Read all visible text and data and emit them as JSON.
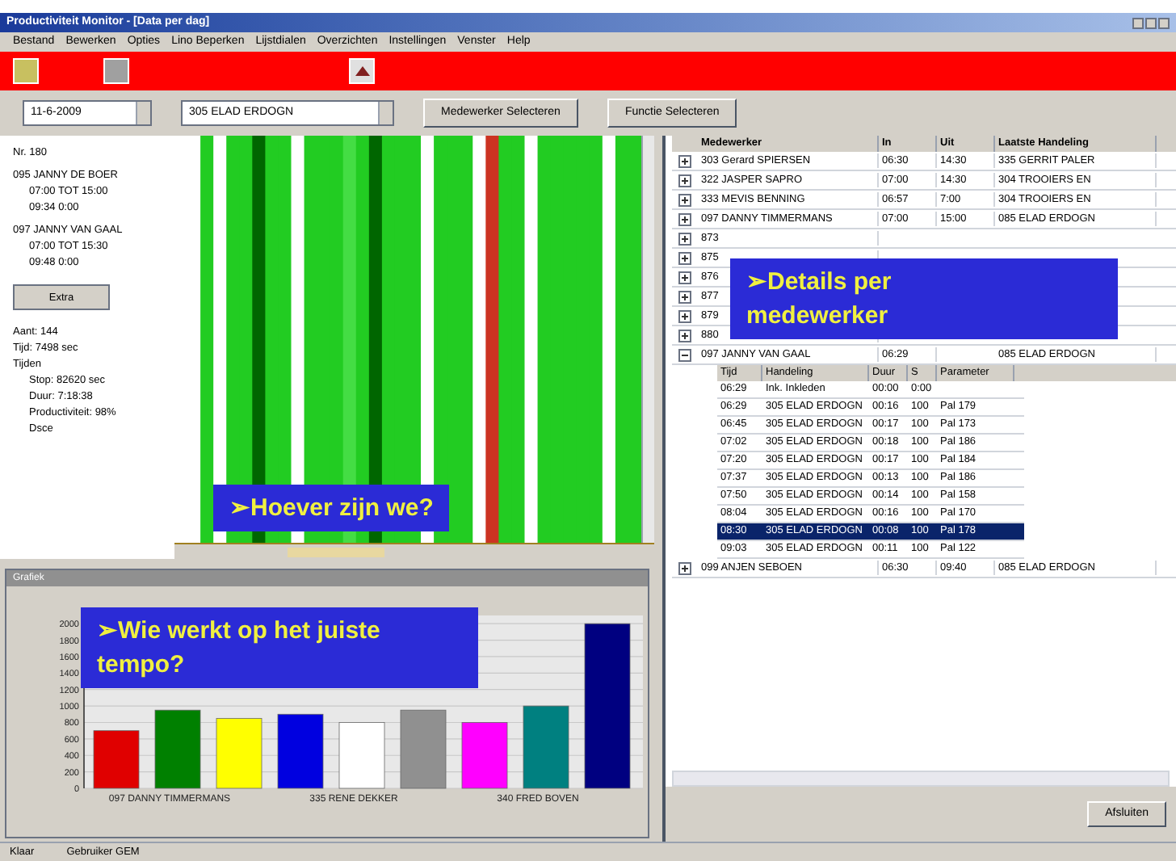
{
  "window": {
    "title": "Productiviteit Monitor - [Data per dag]",
    "menu": [
      "Bestand",
      "Bewerken",
      "Opties",
      "Lino Beperken",
      "Lijstdialen",
      "Overzichten",
      "Instellingen",
      "Venster",
      "Help"
    ]
  },
  "filters": {
    "date": "11-6-2009",
    "employee": "305 ELAD ERDOGN",
    "buttons": [
      "Medewerker Selecteren",
      "Functie Selecteren"
    ]
  },
  "info_panel": {
    "lines": [
      "Nr. 180",
      "095 JANNY DE BOER",
      "07:00 TOT 15:00",
      "09:34 0:00",
      "097 JANNY VAN GAAL",
      "07:00 TOT 15:30",
      "09:48 0:00"
    ],
    "button": "Extra",
    "stats": [
      "Aant: 144",
      "Tijd: 7498 sec",
      "Tijden",
      "Stop: 82620 sec",
      "Duur: 7:18:38",
      "Productiviteit: 98%",
      "Dsce"
    ]
  },
  "progress": {
    "callout": "➢Hoever zijn we?"
  },
  "chart_window": {
    "title": "Grafiek",
    "callout": "➢Wie werkt op het juiste tempo?",
    "chart_data": {
      "type": "bar",
      "categories": [
        "097 DANNY TIMMERMANS",
        "335 RENE DEKKER",
        "340 FRED BOVEN"
      ],
      "series": [
        {
          "values": [
            700,
            900,
            800
          ],
          "colors": [
            "#e00000",
            "#0000e0",
            "#ff00ff"
          ]
        },
        {
          "values": [
            950,
            800,
            1000
          ],
          "colors": [
            "#008000",
            "#ffffff",
            "#008080"
          ]
        },
        {
          "values": [
            850,
            950,
            2000
          ],
          "colors": [
            "#ffff00",
            "#909090",
            "#000080"
          ]
        }
      ],
      "grid": true,
      "ylim": [
        0,
        2100
      ],
      "yticks": [
        0,
        200,
        400,
        600,
        800,
        1000,
        1200,
        1400,
        1600,
        1800,
        2000
      ]
    }
  },
  "employees": {
    "columns": [
      "Medewerker",
      "In",
      "Uit",
      "Laatste Handeling"
    ],
    "callout": "➢Details per medewerker",
    "rows": [
      {
        "cells": [
          "303 Gerard SPIERSEN",
          "06:30",
          "14:30",
          "335 GERRIT PALER"
        ],
        "expanded": false
      },
      {
        "cells": [
          "322 JASPER SAPRO",
          "07:00",
          "14:30",
          "304 TROOIERS EN"
        ],
        "expanded": false
      },
      {
        "cells": [
          "333 MEVIS BENNING",
          "06:57",
          "7:00",
          "304 TROOIERS EN"
        ],
        "expanded": false
      },
      {
        "cells": [
          "097 DANNY TIMMERMANS",
          "07:00",
          "15:00",
          "085 ELAD ERDOGN"
        ],
        "expanded": false
      },
      {
        "cells": [
          "873"
        ],
        "expanded": false
      },
      {
        "cells": [
          "875"
        ],
        "expanded": false
      },
      {
        "cells": [
          "876"
        ],
        "expanded": false
      },
      {
        "cells": [
          "877"
        ],
        "expanded": false
      },
      {
        "cells": [
          "879"
        ],
        "expanded": false
      },
      {
        "cells": [
          "880"
        ],
        "expanded": false
      },
      {
        "cells": [
          "097 JANNY VAN GAAL",
          "06:29",
          "",
          "085 ELAD ERDOGN"
        ],
        "expanded": true,
        "detail_columns": [
          "Tijd",
          "Handeling",
          "Duur",
          "S",
          "Parameter"
        ],
        "children": [
          {
            "cells": [
              "06:29",
              "Ink. Inkleden",
              "00:00",
              "0:00",
              ""
            ],
            "selected": false
          },
          {
            "cells": [
              "06:29",
              "305 ELAD ERDOGN",
              "00:16",
              "100",
              "Pal 179"
            ],
            "selected": false
          },
          {
            "cells": [
              "06:45",
              "305 ELAD ERDOGN",
              "00:17",
              "100",
              "Pal 173"
            ],
            "selected": false
          },
          {
            "cells": [
              "07:02",
              "305 ELAD ERDOGN",
              "00:18",
              "100",
              "Pal 186"
            ],
            "selected": false
          },
          {
            "cells": [
              "07:20",
              "305 ELAD ERDOGN",
              "00:17",
              "100",
              "Pal 184"
            ],
            "selected": false
          },
          {
            "cells": [
              "07:37",
              "305 ELAD ERDOGN",
              "00:13",
              "100",
              "Pal 186"
            ],
            "selected": false
          },
          {
            "cells": [
              "07:50",
              "305 ELAD ERDOGN",
              "00:14",
              "100",
              "Pal 158"
            ],
            "selected": false
          },
          {
            "cells": [
              "08:04",
              "305 ELAD ERDOGN",
              "00:16",
              "100",
              "Pal 170"
            ],
            "selected": false
          },
          {
            "cells": [
              "08:30",
              "305 ELAD ERDOGN",
              "00:08",
              "100",
              "Pal 178"
            ],
            "selected": true
          },
          {
            "cells": [
              "09:03",
              "305 ELAD ERDOGN",
              "00:11",
              "100",
              "Pal 122"
            ],
            "selected": false
          }
        ]
      },
      {
        "cells": [
          "099 ANJEN SEBOEN",
          "06:30",
          "09:40",
          "085 ELAD ERDOGN"
        ],
        "expanded": false
      }
    ],
    "button": "Afsluiten"
  },
  "status_bar": [
    "Klaar",
    "Gebruiker GEM"
  ]
}
